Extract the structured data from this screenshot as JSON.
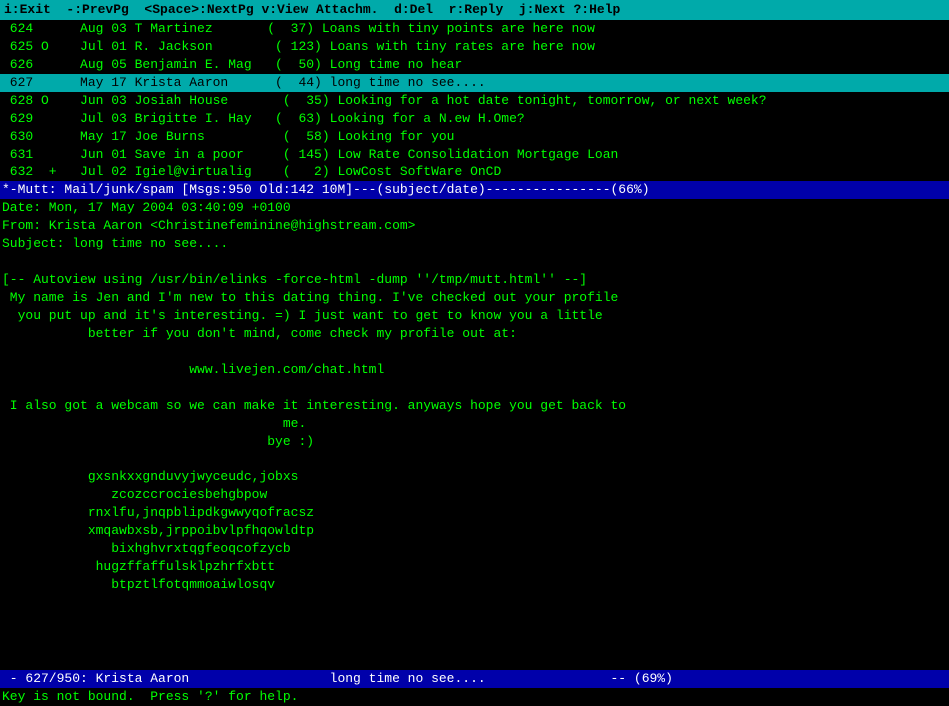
{
  "topbar": {
    "text": "i:Exit  -:PrevPg  <Space>:NextPg v:View Attachm.  d:Del  r:Reply  j:Next ?:Help"
  },
  "emailList": [
    {
      "id": "624",
      "date": "Aug 03",
      "sender": "T Martinez",
      "count": "( 37)",
      "subject": "Loans with tiny points are here now",
      "flags": "",
      "selected": false
    },
    {
      "id": "625",
      "date": "Jul 01",
      "sender": "R. Jackson",
      "count": "(123)",
      "subject": "Loans with tiny rates are here now",
      "flags": "O",
      "selected": false
    },
    {
      "id": "626",
      "date": "Aug 05",
      "sender": "Benjamin E. Mag",
      "count": "( 50)",
      "subject": "Long time no hear",
      "flags": "",
      "selected": false
    },
    {
      "id": "627",
      "date": "May 17",
      "sender": "Krista Aaron",
      "count": "( 44)",
      "subject": "long time no see....",
      "flags": "",
      "selected": true
    },
    {
      "id": "628",
      "date": "Jun 03",
      "sender": "Josiah House",
      "count": "( 35)",
      "subject": "Looking for a hot date tonight, tomorrow, or next week?",
      "flags": "O",
      "selected": false
    },
    {
      "id": "629",
      "date": "Jul 03",
      "sender": "Brigitte I. Hay",
      "count": "( 63)",
      "subject": "Looking for a N.ew H.Ome?",
      "flags": "",
      "selected": false
    },
    {
      "id": "630",
      "date": "May 17",
      "sender": "Joe Burns",
      "count": "( 58)",
      "subject": "Looking for you",
      "flags": "",
      "selected": false
    },
    {
      "id": "631",
      "date": "Jun 01",
      "sender": "Save in a poor",
      "count": "(145)",
      "subject": "Low Rate Consolidation Mortgage Loan",
      "flags": "",
      "selected": false
    },
    {
      "id": "632",
      "date": "Jul 02",
      "sender": "Igiel@virtualig",
      "count": "(  2)",
      "subject": "LowCost SoftWare OnCD",
      "flags": "+",
      "selected": false
    }
  ],
  "muttStatusBar": "*-Mutt: Mail/junk/spam [Msgs:950 Old:142 10M]---(subject/date)----------------(66%)",
  "emailDate": "Date: Mon, 17 May 2004 03:40:09 +0100",
  "emailFrom": "From: Krista Aaron <Christinefeminine@highstream.com>",
  "emailSubject": "Subject: long time no see....",
  "autoviewLine": "[-- Autoview using /usr/bin/elinks -force-html -dump ''/tmp/mutt.html'' --]",
  "emailBody": {
    "line1": " My name is Jen and I'm new to this dating thing. I've checked out your profile",
    "line2": "  you put up and it's interesting. =) I just want to get to know you a little",
    "line3": "           better if you don't mind, come check my profile out at:",
    "line4": "",
    "line5": "                        www.livejen.com/chat.html",
    "line6": "",
    "line7": " I also got a webcam so we can make it interesting. anyways hope you get back to",
    "line8": "                                    me.",
    "line9": "                                  bye :)",
    "line10": "",
    "line11": "           gxsnkxxgnduvyjwyceudc,jobxs",
    "line12": "              zcozccrociesbehgbpow",
    "line13": "           rnxlfu,jnqpblipdkgwwyqofracsz",
    "line14": "           xmqawbxsb,jrppoibvlpfhqowldtp",
    "line15": "              bixhghvrxtqgfeoqcofzycb",
    "line16": "            hugzffaffulsklpzhrfxbtt",
    "line17": "              btpztlfotqmmoaiwlosqv"
  },
  "bottomStatusBar": " - 627/950: Krista Aaron                  long time no see....                -- (69%)",
  "bottomHelp": "Key is not bound.  Press '?' for help."
}
